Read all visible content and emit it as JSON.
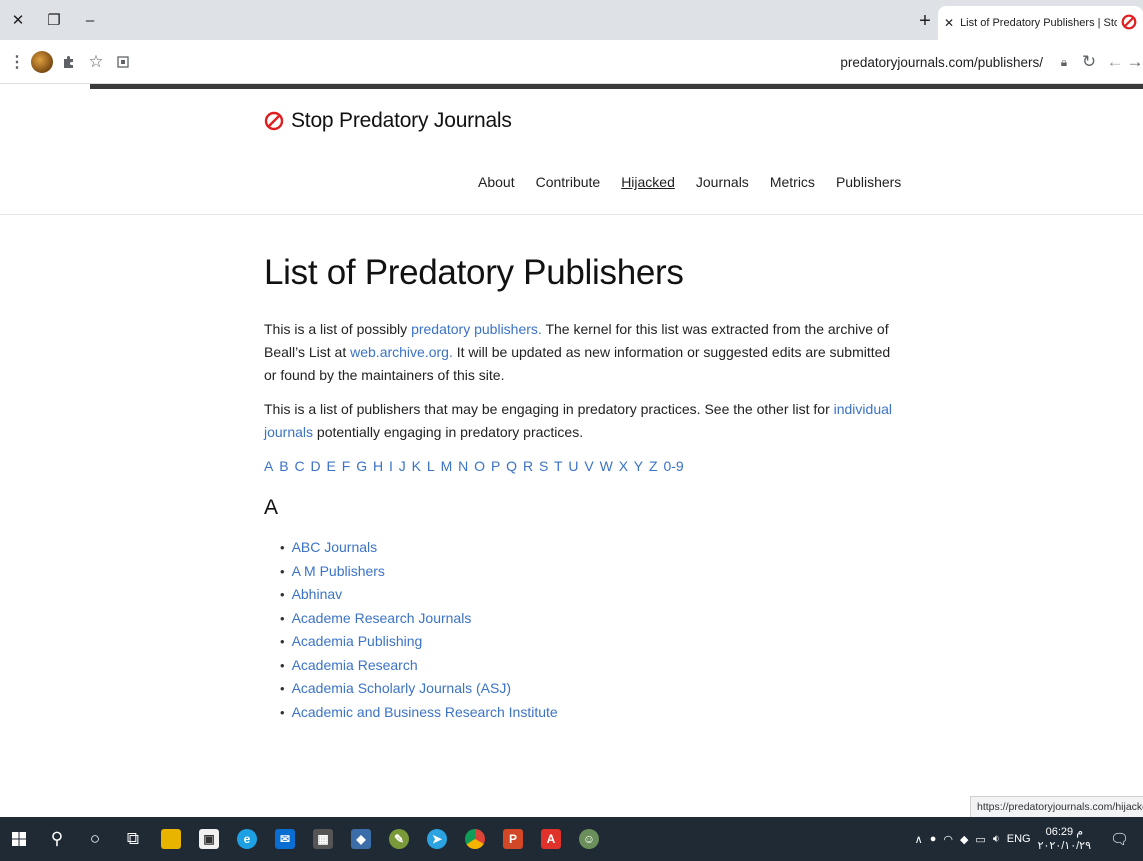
{
  "browser": {
    "tab_title": "List of Predatory Publishers | Stop Predatory Journals",
    "url": "predatoryjournals.com/publishers/",
    "status_link": "https://predatoryjournals.com/hijacked/"
  },
  "site": {
    "brand": "Stop Predatory Journals",
    "accent_color": "#e02020",
    "nav": [
      "About",
      "Contribute",
      "Hijacked",
      "Journals",
      "Metrics",
      "Publishers"
    ],
    "nav_active": "Hijacked"
  },
  "main": {
    "title": "List of Predatory Publishers",
    "intro1": {
      "before": "This is a list of possibly ",
      "link1": "predatory publishers.",
      "middle": " The kernel for this list was extracted from the archive of Beall’s List at ",
      "link2": "web.archive.org.",
      "after": " It will be updated as new information or suggested edits are submitted or found by the maintainers of this site."
    },
    "intro2": {
      "before": "This is a list of publishers that may be engaging in predatory practices. See the other list for ",
      "link": "individual journals",
      "after": " potentially engaging in predatory practices."
    },
    "letters": [
      "A",
      "B",
      "C",
      "D",
      "E",
      "F",
      "G",
      "H",
      "I",
      "J",
      "K",
      "L",
      "M",
      "N",
      "O",
      "P",
      "Q",
      "R",
      "S",
      "T",
      "U",
      "V",
      "W",
      "X",
      "Y",
      "Z",
      "0-9"
    ],
    "section_heading": "A",
    "publishers": [
      "ABC Journals",
      "A M Publishers",
      "Abhinav",
      "Academe Research Journals",
      "Academia Publishing",
      "Academia Research",
      "Academia Scholarly Journals (ASJ)",
      "Academic and Business Research Institute"
    ]
  },
  "taskbar": {
    "lang": "ENG",
    "time": "06:29 م",
    "date": "٢٠٢٠/١٠/٢٩"
  }
}
